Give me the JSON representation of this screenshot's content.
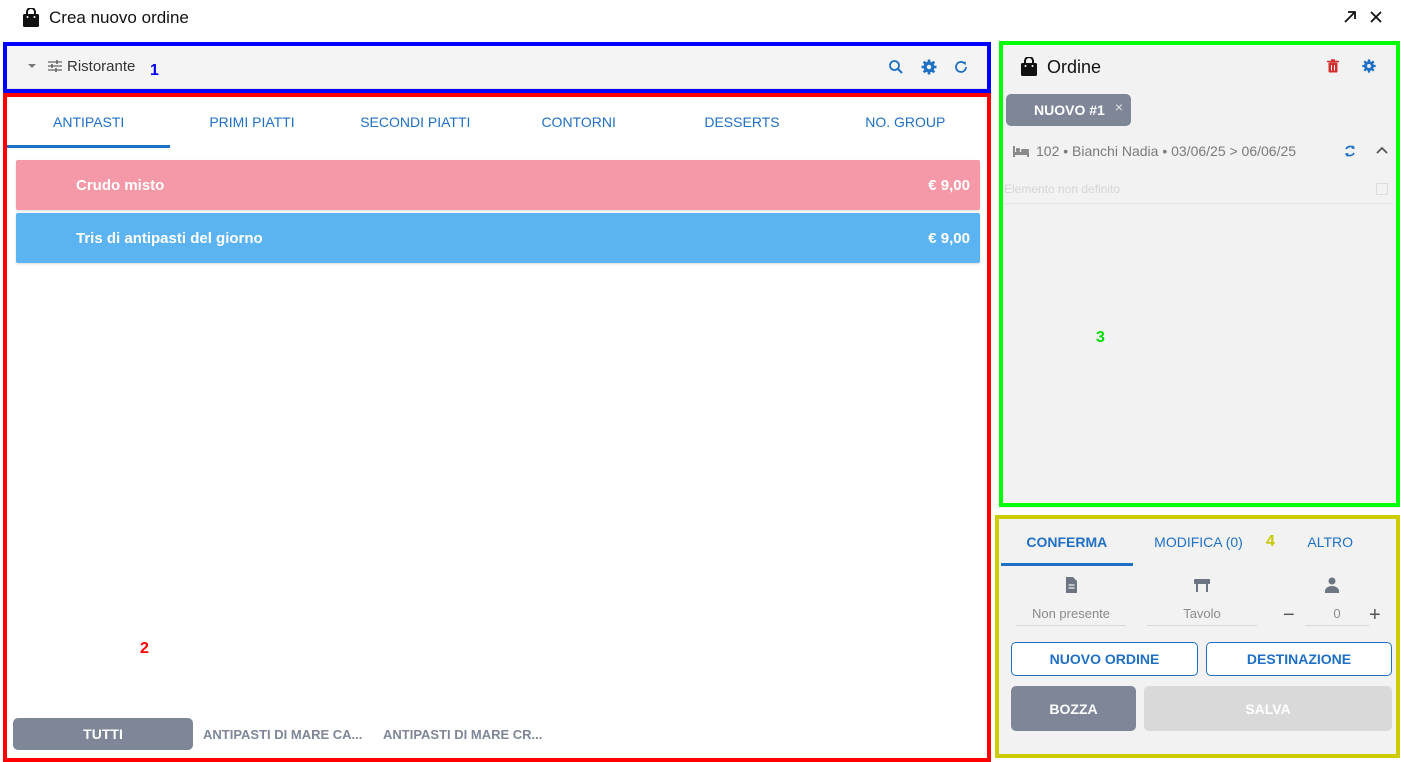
{
  "window": {
    "title": "Crea nuovo ordine"
  },
  "toolbar": {
    "filter_label": "Ristorante"
  },
  "categories": {
    "tabs": [
      {
        "label": "ANTIPASTI",
        "active": true
      },
      {
        "label": "PRIMI PIATTI"
      },
      {
        "label": "SECONDI PIATTI"
      },
      {
        "label": "CONTORNI"
      },
      {
        "label": "DESSERTS"
      },
      {
        "label": "NO. GROUP"
      }
    ]
  },
  "menu_items": [
    {
      "name": "Crudo misto",
      "price": "€ 9,00",
      "color": "#f599a8"
    },
    {
      "name": "Tris di antipasti del giorno",
      "price": "€ 9,00",
      "color": "#5cb3f2"
    }
  ],
  "subgroups": {
    "all": "TUTTI",
    "items": [
      "ANTIPASTI DI MARE CA...",
      "ANTIPASTI DI MARE CR..."
    ]
  },
  "order": {
    "title": "Ordine",
    "chip_label": "NUOVO #1",
    "chip_close": "×",
    "guest_info": "102 • Bianchi Nadia • 03/06/25 > 06/06/25",
    "undefined_item": "Elemento non definito"
  },
  "actions": {
    "tabs": [
      {
        "label": "CONFERMA",
        "active": true
      },
      {
        "label": "MODIFICA (0)"
      },
      {
        "label": "ALTRO"
      }
    ],
    "document_value": "Non presente",
    "table_value": "Tavolo",
    "covers_value": "0",
    "minus": "−",
    "plus": "+",
    "new_order_label": "NUOVO ORDINE",
    "destination_label": "DESTINAZIONE",
    "draft_label": "BOZZA",
    "save_label": "SALVA"
  },
  "annotations": [
    "1",
    "2",
    "3",
    "4"
  ],
  "colors": {
    "accent": "#1f6fc4",
    "box1": "#0000ff",
    "box2": "#ff0000",
    "box3": "#00ff00",
    "box4": "#cccc00",
    "delete_icon": "#d32f2f",
    "chip": "#7e8698"
  }
}
